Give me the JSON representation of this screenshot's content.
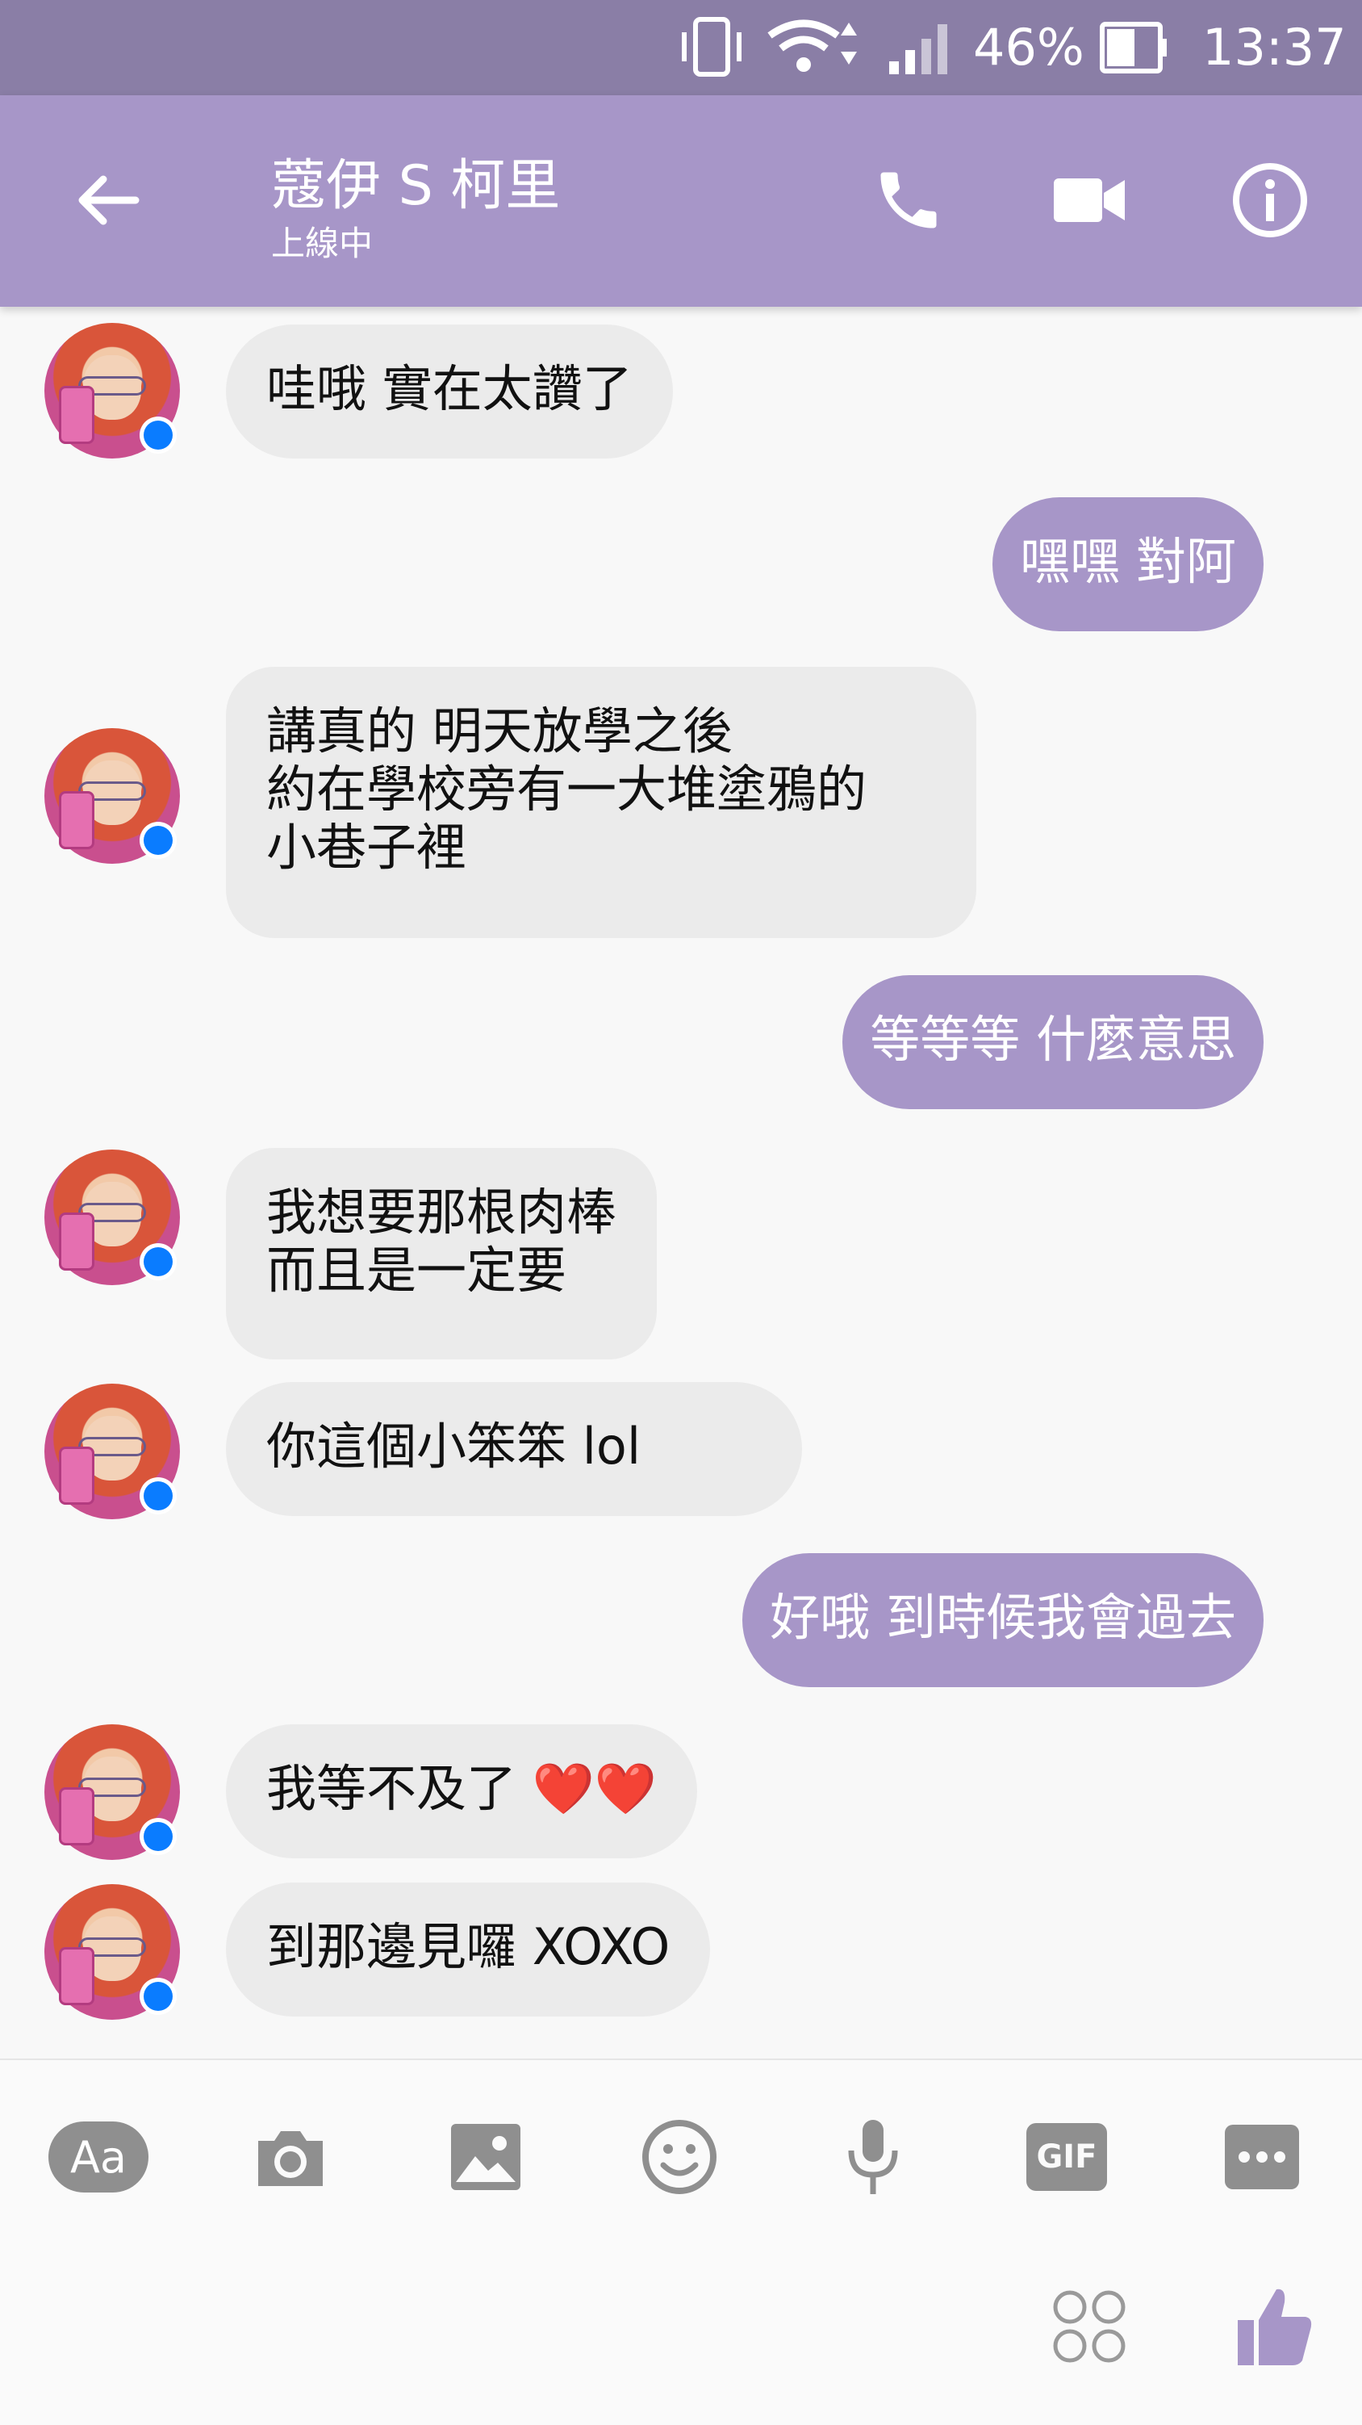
{
  "status_bar": {
    "battery": "46%",
    "time": "13:37"
  },
  "header": {
    "contact_name": "蔻伊 S 柯里",
    "status": "上線中",
    "icons": [
      "back-arrow-icon",
      "phone-icon",
      "video-camera-icon",
      "info-icon"
    ]
  },
  "messages": [
    {
      "sender": "contact",
      "text": "哇哦 實在太讚了"
    },
    {
      "sender": "me",
      "text": "嘿嘿 對阿"
    },
    {
      "sender": "contact",
      "text": "講真的 明天放學之後\n約在學校旁有一大堆塗鴉的\n小巷子裡"
    },
    {
      "sender": "me",
      "text": "等等等 什麼意思"
    },
    {
      "sender": "contact",
      "text": "我想要那根肉棒\n而且是一定要"
    },
    {
      "sender": "contact",
      "text": "你這個小笨笨 lol"
    },
    {
      "sender": "me",
      "text": "好哦 到時候我會過去"
    },
    {
      "sender": "contact",
      "text": "我等不及了 ❤️❤️"
    },
    {
      "sender": "contact",
      "text": "到那邊見囉 XOXO"
    }
  ],
  "composer": {
    "text_label": "Aa",
    "gif_label": "GIF",
    "icons": [
      "text-format-icon",
      "camera-icon",
      "image-icon",
      "emoji-icon",
      "microphone-icon",
      "gif-icon",
      "more-icon",
      "stickers-icon",
      "thumbs-up-icon"
    ]
  },
  "colors": {
    "statusbar": "#8a7ea6",
    "header": "#a796c8",
    "outgoing": "#a796c8",
    "incoming": "#ebebeb"
  }
}
